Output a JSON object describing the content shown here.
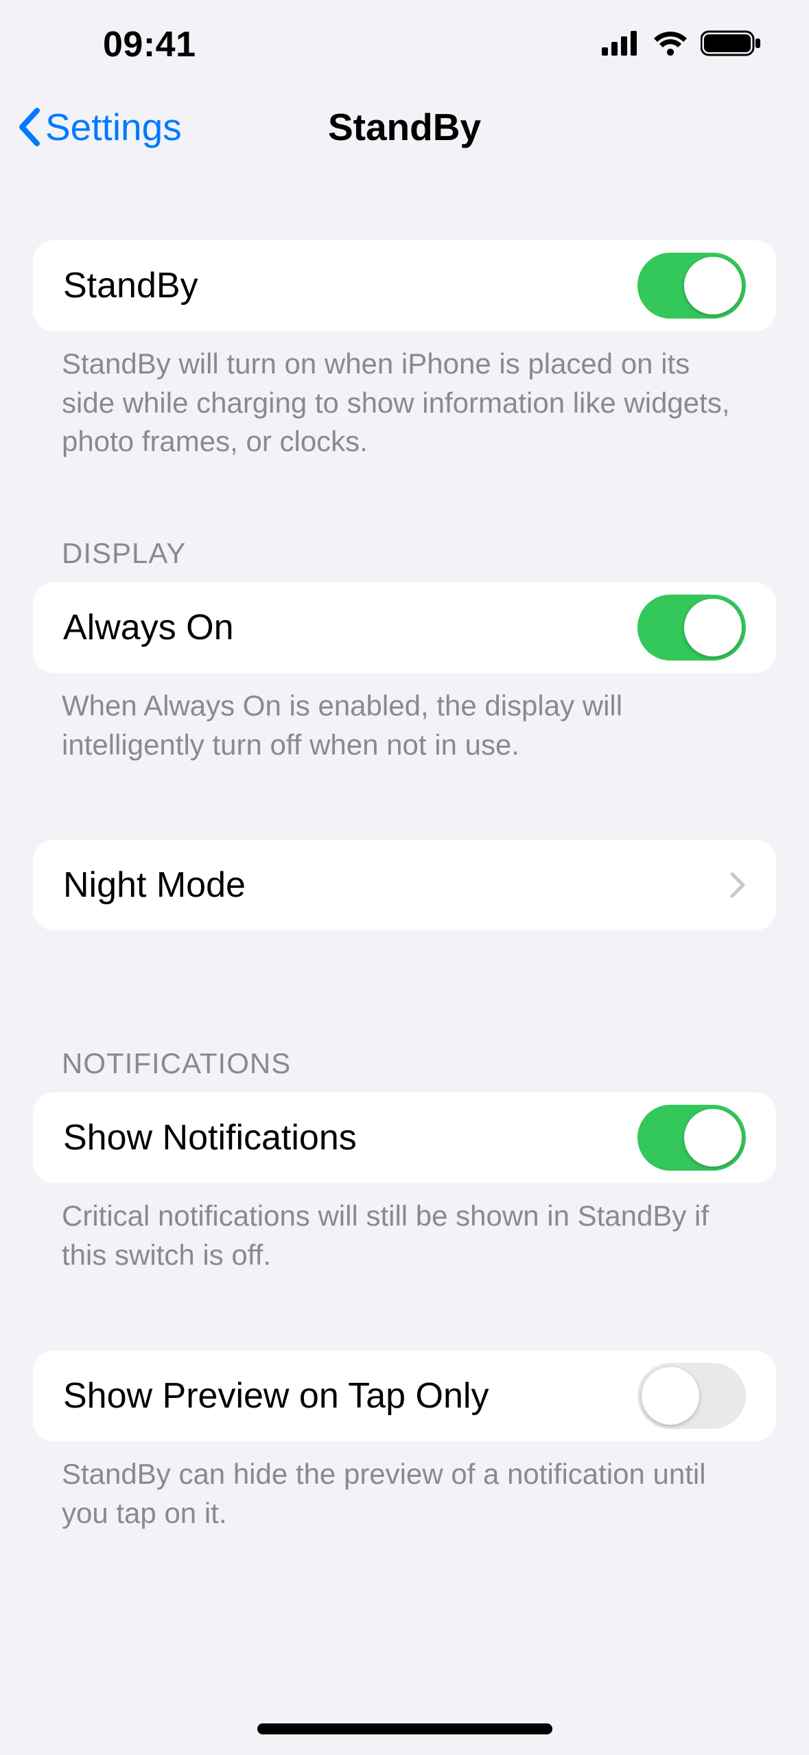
{
  "status": {
    "time": "09:41"
  },
  "nav": {
    "back_label": "Settings",
    "title": "StandBy"
  },
  "sections": {
    "main": {
      "standby_label": "StandBy",
      "standby_on": true,
      "standby_footer": "StandBy will turn on when iPhone is placed on its side while charging to show information like widgets, photo frames, or clocks."
    },
    "display": {
      "header": "DISPLAY",
      "always_on_label": "Always On",
      "always_on_on": true,
      "always_on_footer": "When Always On is enabled, the display will intelligently turn off when not in use.",
      "night_mode_label": "Night Mode"
    },
    "notifications": {
      "header": "NOTIFICATIONS",
      "show_notif_label": "Show Notifications",
      "show_notif_on": true,
      "show_notif_footer": "Critical notifications will still be shown in StandBy if this switch is off.",
      "preview_label": "Show Preview on Tap Only",
      "preview_on": false,
      "preview_footer": "StandBy can hide the preview of a notification until you tap on it."
    }
  },
  "colors": {
    "accent": "#007aff",
    "switch_on": "#34c759"
  }
}
